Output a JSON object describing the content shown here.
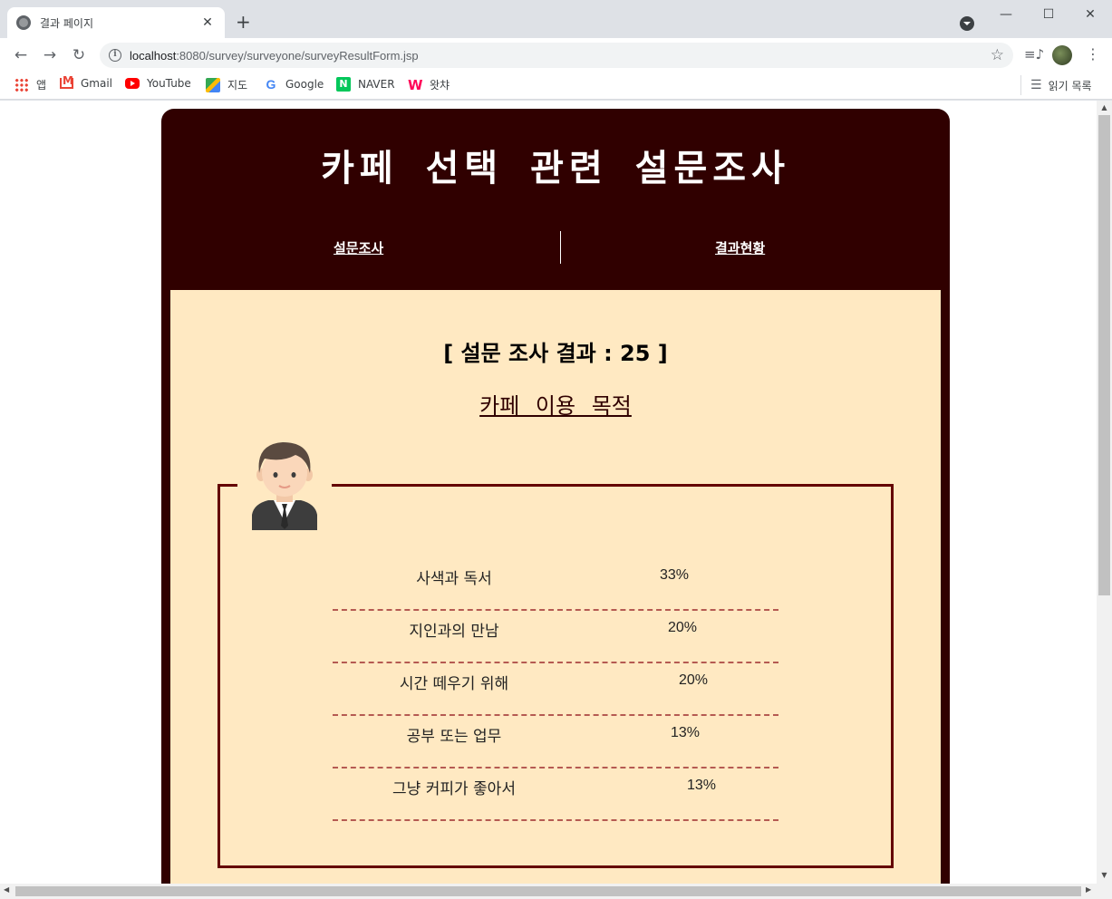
{
  "browser": {
    "tab_title": "결과 페이지",
    "url_host": "localhost",
    "url_rest": ":8080/survey/surveyone/surveyResultForm.jsp",
    "bookmarks": [
      "앱",
      "Gmail",
      "YouTube",
      "지도",
      "Google",
      "NAVER",
      "왓챠"
    ],
    "reading_list": "읽기 목록"
  },
  "page": {
    "title": "카페 선택 관련 설문조사",
    "nav": {
      "survey": "설문조사",
      "results": "결과현황"
    },
    "result_title": "[ 설문 조사 결과 : 25 ]",
    "question_title": "카페 이용 목적",
    "results": [
      {
        "label": "사색과 독서",
        "percent": "33%"
      },
      {
        "label": "지인과의 만남",
        "percent": "20%"
      },
      {
        "label": "시간 떼우기 위해",
        "percent": "20%"
      },
      {
        "label": "공부 또는 업무",
        "percent": "13%"
      },
      {
        "label": "그냥 커피가 좋아서",
        "percent": "13%"
      }
    ]
  },
  "colors": {
    "header_bg": "#300000",
    "content_bg": "#ffe9c2",
    "box_border": "#640000",
    "row_divider": "#b55a52"
  },
  "icons": [
    "globe-icon",
    "close-icon",
    "plus-icon",
    "back-icon",
    "forward-icon",
    "reload-icon",
    "info-icon",
    "star-icon",
    "media-icon",
    "menu-icon",
    "person-avatar-icon"
  ]
}
